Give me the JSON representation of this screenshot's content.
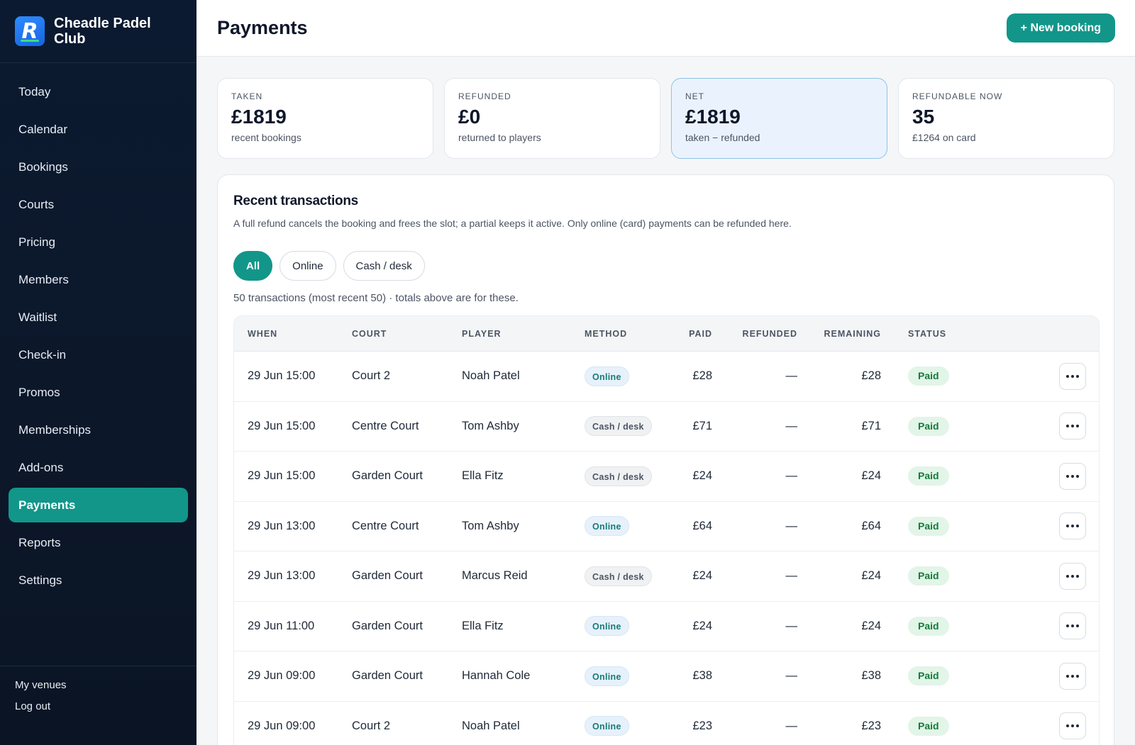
{
  "brand": {
    "name": "Cheadle Padel Club",
    "logo_letter": "R"
  },
  "nav": [
    {
      "label": "Today",
      "active": false
    },
    {
      "label": "Calendar",
      "active": false
    },
    {
      "label": "Bookings",
      "active": false
    },
    {
      "label": "Courts",
      "active": false
    },
    {
      "label": "Pricing",
      "active": false
    },
    {
      "label": "Members",
      "active": false
    },
    {
      "label": "Waitlist",
      "active": false
    },
    {
      "label": "Check-in",
      "active": false
    },
    {
      "label": "Promos",
      "active": false
    },
    {
      "label": "Memberships",
      "active": false
    },
    {
      "label": "Add-ons",
      "active": false
    },
    {
      "label": "Payments",
      "active": true
    },
    {
      "label": "Reports",
      "active": false
    },
    {
      "label": "Settings",
      "active": false
    }
  ],
  "footer": {
    "my_venues": "My venues",
    "log_out": "Log out"
  },
  "header": {
    "title": "Payments",
    "new_booking": "+ New booking"
  },
  "stats": [
    {
      "label": "TAKEN",
      "value": "£1819",
      "sub": "recent bookings",
      "highlight": false
    },
    {
      "label": "REFUNDED",
      "value": "£0",
      "sub": "returned to players",
      "highlight": false
    },
    {
      "label": "NET",
      "value": "£1819",
      "sub": "taken − refunded",
      "highlight": true
    },
    {
      "label": "REFUNDABLE NOW",
      "value": "35",
      "sub": "£1264 on card",
      "highlight": false
    }
  ],
  "transactions": {
    "title": "Recent transactions",
    "description": "A full refund cancels the booking and frees the slot; a partial keeps it active. Only online (card) payments can be refunded here.",
    "filters": [
      {
        "label": "All",
        "active": true
      },
      {
        "label": "Online",
        "active": false
      },
      {
        "label": "Cash / desk",
        "active": false
      }
    ],
    "count_note": "50 transactions (most recent 50) · totals above are for these.",
    "columns": {
      "when": "WHEN",
      "court": "COURT",
      "player": "PLAYER",
      "method": "METHOD",
      "paid": "PAID",
      "refunded": "REFUNDED",
      "remaining": "REMAINING",
      "status": "STATUS"
    },
    "rows": [
      {
        "when": "29 Jun 15:00",
        "court": "Court 2",
        "player": "Noah Patel",
        "method": "Online",
        "method_type": "online",
        "paid": "£28",
        "refunded": "—",
        "remaining": "£28",
        "status": "Paid"
      },
      {
        "when": "29 Jun 15:00",
        "court": "Centre Court",
        "player": "Tom Ashby",
        "method": "Cash / desk",
        "method_type": "cash",
        "paid": "£71",
        "refunded": "—",
        "remaining": "£71",
        "status": "Paid"
      },
      {
        "when": "29 Jun 15:00",
        "court": "Garden Court",
        "player": "Ella Fitz",
        "method": "Cash / desk",
        "method_type": "cash",
        "paid": "£24",
        "refunded": "—",
        "remaining": "£24",
        "status": "Paid"
      },
      {
        "when": "29 Jun 13:00",
        "court": "Centre Court",
        "player": "Tom Ashby",
        "method": "Online",
        "method_type": "online",
        "paid": "£64",
        "refunded": "—",
        "remaining": "£64",
        "status": "Paid"
      },
      {
        "when": "29 Jun 13:00",
        "court": "Garden Court",
        "player": "Marcus Reid",
        "method": "Cash / desk",
        "method_type": "cash",
        "paid": "£24",
        "refunded": "—",
        "remaining": "£24",
        "status": "Paid"
      },
      {
        "when": "29 Jun 11:00",
        "court": "Garden Court",
        "player": "Ella Fitz",
        "method": "Online",
        "method_type": "online",
        "paid": "£24",
        "refunded": "—",
        "remaining": "£24",
        "status": "Paid"
      },
      {
        "when": "29 Jun 09:00",
        "court": "Garden Court",
        "player": "Hannah Cole",
        "method": "Online",
        "method_type": "online",
        "paid": "£38",
        "refunded": "—",
        "remaining": "£38",
        "status": "Paid"
      },
      {
        "when": "29 Jun 09:00",
        "court": "Court 2",
        "player": "Noah Patel",
        "method": "Online",
        "method_type": "online",
        "paid": "£23",
        "refunded": "—",
        "remaining": "£23",
        "status": "Paid"
      }
    ]
  },
  "colors": {
    "accent": "#12968a",
    "sidebar_bg": "#0b1a30",
    "status_paid_bg": "#e2f5e8",
    "net_card_bg": "#eaf3fd"
  },
  "icons": {
    "row_action": "more-horizontal-icon",
    "logo": "brand-logo-icon"
  }
}
